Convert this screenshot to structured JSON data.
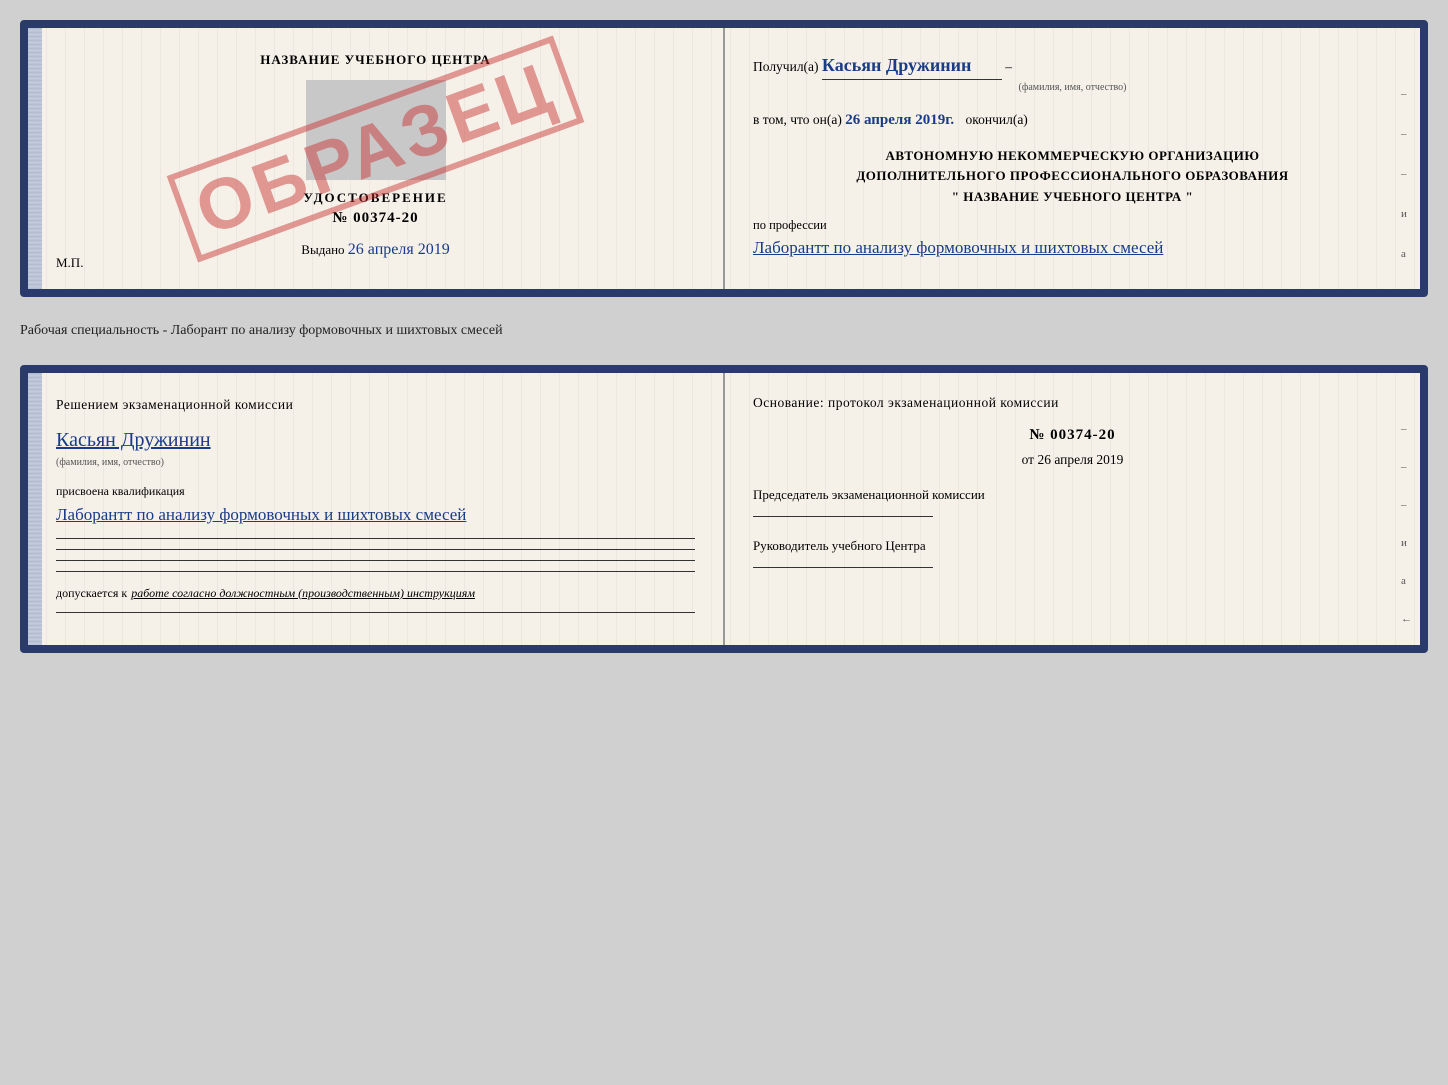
{
  "top_card": {
    "left": {
      "title": "НАЗВАНИЕ УЧЕБНОГО ЦЕНТРА",
      "cert_label": "УДОСТОВЕРЕНИЕ",
      "cert_number": "№ 00374-20",
      "issued_label": "Выдано",
      "issued_date": "26 апреля 2019",
      "stamp": "ОБРАЗЕЦ",
      "mp_label": "М.П."
    },
    "right": {
      "received_label": "Получил(а)",
      "received_name": "Касьян Дружинин",
      "fio_caption": "(фамилия, имя, отчество)",
      "in_that_label": "в том, что он(а)",
      "completed_date": "26 апреля 2019г.",
      "completed_label": "окончил(а)",
      "org_line1": "АВТОНОМНУЮ НЕКОММЕРЧЕСКУЮ ОРГАНИЗАЦИЮ",
      "org_line2": "ДОПОЛНИТЕЛЬНОГО ПРОФЕССИОНАЛЬНОГО ОБРАЗОВАНИЯ",
      "org_name": "\"  НАЗВАНИЕ УЧЕБНОГО ЦЕНТРА  \"",
      "profession_label": "по профессии",
      "profession_text": "Лаборантт по анализу формовочных и шихтовых смесей",
      "dash1": "–",
      "dash2": "–",
      "dash3": "–",
      "dash4": "и",
      "dash5": "а",
      "dash6": "←",
      "dash7": "–",
      "dash8": "–"
    }
  },
  "middle": {
    "text": "Рабочая специальность - Лаборант по анализу формовочных и шихтовых смесей"
  },
  "bottom_card": {
    "left": {
      "decision_title": "Решением экзаменационной комиссии",
      "name": "Касьян Дружинин",
      "fio_caption": "(фамилия, имя, отчество)",
      "qual_label": "присвоена квалификация",
      "qual_text": "Лаборантт по анализу формовочных и шихтовых смесей",
      "dopusk_label": "допускается к",
      "dopusk_text": "работе согласно должностным (производственным) инструкциям"
    },
    "right": {
      "osnov_title": "Основание: протокол экзаменационной комиссии",
      "protocol_number": "№ 00374-20",
      "protocol_date_prefix": "от",
      "protocol_date": "26 апреля 2019",
      "chairman_title": "Председатель экзаменационной комиссии",
      "director_title": "Руководитель учебного Центра",
      "dash1": "–",
      "dash2": "–",
      "dash3": "–",
      "dash4": "и",
      "dash5": "а",
      "dash6": "←",
      "dash7": "–",
      "dash8": "–"
    }
  }
}
